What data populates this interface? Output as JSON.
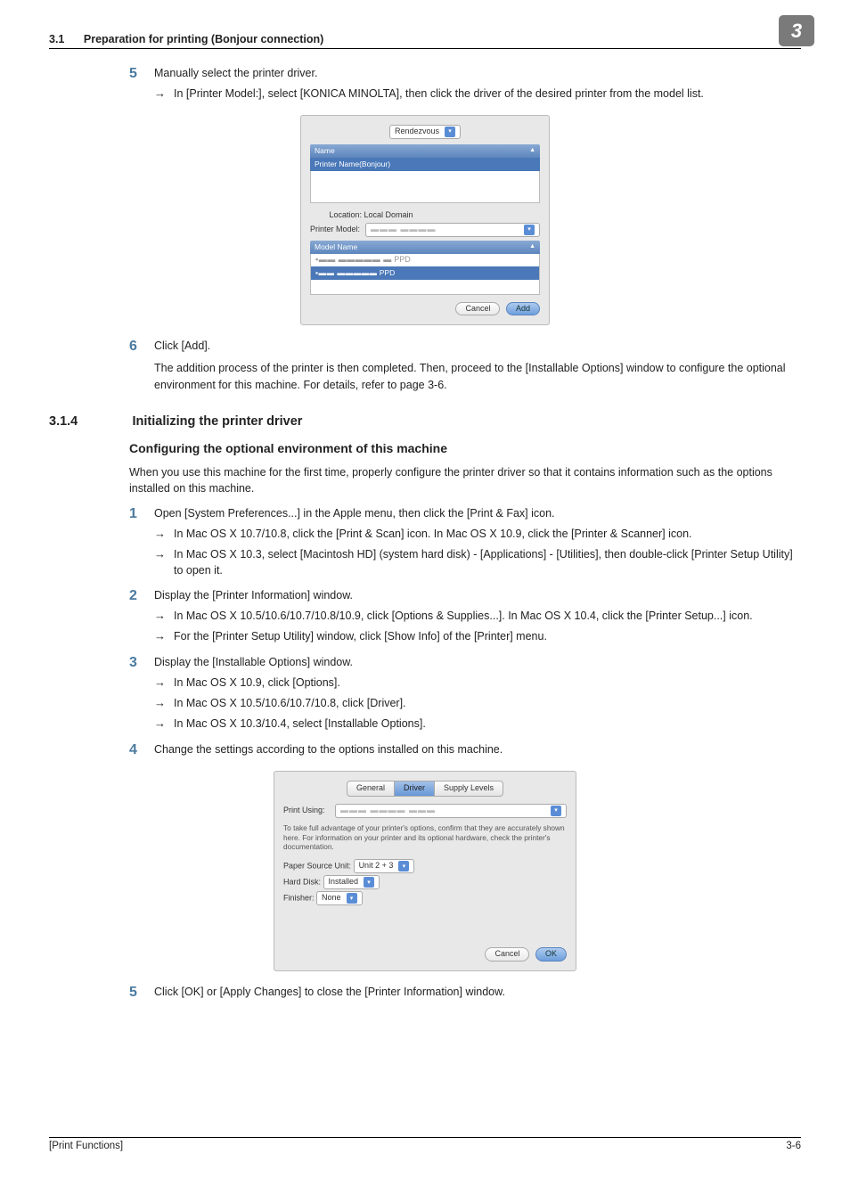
{
  "header": {
    "section_num": "3.1",
    "section_title": "Preparation for printing (Bonjour connection)",
    "tab_number": "3"
  },
  "step5": {
    "num": "5",
    "text": "Manually select the printer driver.",
    "sub1": "In [Printer Model:], select [KONICA MINOLTA], then click the driver of the desired printer from the model list."
  },
  "fig1": {
    "combo_top": "Rendezvous",
    "name_header": "Name",
    "name_row": "Printer Name(Bonjour)",
    "location_lbl": "Location:",
    "location_val": "Local Domain",
    "pmodel_lbl": "Printer Model:",
    "mn_header": "Model Name",
    "mn_row1_suffix": "PPD",
    "mn_row2_suffix": "PPD",
    "cancel": "Cancel",
    "add": "Add"
  },
  "step6": {
    "num": "6",
    "text": "Click [Add].",
    "para": "The addition process of the printer is then completed. Then, proceed to the [Installable Options] window to configure the optional environment for this machine. For details, refer to page 3-6."
  },
  "sec314": {
    "num": "3.1.4",
    "title": "Initializing the printer driver",
    "sub": "Configuring the optional environment of this machine",
    "para": "When you use this machine for the first time, properly configure the printer driver so that it contains information such as the options installed on this machine."
  },
  "sstep1": {
    "num": "1",
    "text": "Open [System Preferences...] in the Apple menu, then click the [Print & Fax] icon.",
    "sub1": "In Mac OS X 10.7/10.8, click the [Print & Scan] icon. In Mac OS X 10.9, click the [Printer & Scanner] icon.",
    "sub2": "In Mac OS X 10.3, select [Macintosh HD] (system hard disk) - [Applications] - [Utilities], then double-click [Printer Setup Utility] to open it."
  },
  "sstep2": {
    "num": "2",
    "text": "Display the [Printer Information] window.",
    "sub1": "In Mac OS X 10.5/10.6/10.7/10.8/10.9, click [Options & Supplies...]. In Mac OS X 10.4, click the [Printer Setup...] icon.",
    "sub2": "For the [Printer Setup Utility] window, click [Show Info] of the [Printer] menu."
  },
  "sstep3": {
    "num": "3",
    "text": "Display the [Installable Options] window.",
    "sub1": "In Mac OS X 10.9, click [Options].",
    "sub2": "In Mac OS X 10.5/10.6/10.7/10.8, click [Driver].",
    "sub3": "In Mac OS X 10.3/10.4, select [Installable Options]."
  },
  "sstep4": {
    "num": "4",
    "text": "Change the settings according to the options installed on this machine."
  },
  "fig2": {
    "tab_general": "General",
    "tab_driver": "Driver",
    "tab_supply": "Supply Levels",
    "pu_lbl": "Print Using:",
    "desc": "To take full advantage of your printer's options, confirm that they are accurately shown here. For information on your printer and its optional hardware, check the printer's documentation.",
    "psu_lbl": "Paper Source Unit:",
    "psu_val": "Unit 2 + 3",
    "hd_lbl": "Hard Disk:",
    "hd_val": "Installed",
    "fin_lbl": "Finisher:",
    "fin_val": "None",
    "cancel": "Cancel",
    "ok": "OK"
  },
  "sstep5": {
    "num": "5",
    "text": "Click [OK] or [Apply Changes] to close the [Printer Information] window."
  },
  "footer": {
    "left": "[Print Functions]",
    "right": "3-6"
  }
}
